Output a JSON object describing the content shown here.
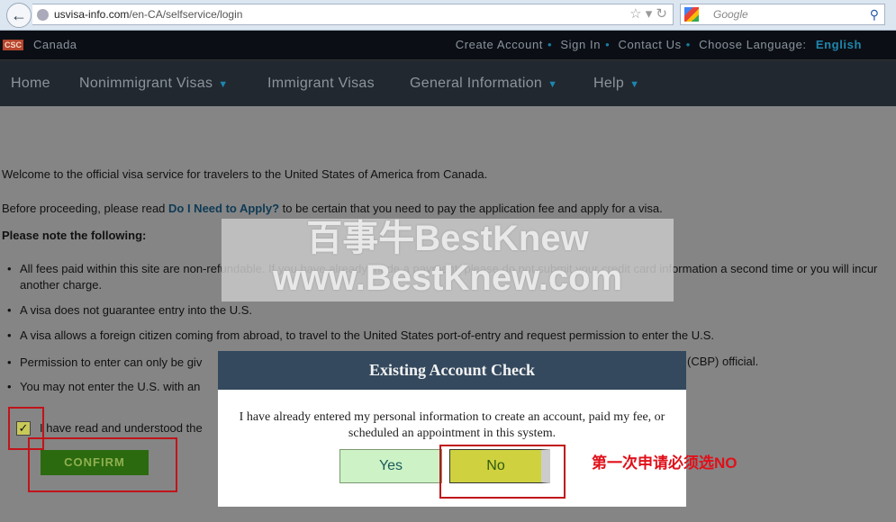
{
  "browser": {
    "url_host": "usvisa-info.com",
    "url_path": "/en-CA/selfservice/login",
    "search_placeholder": "Google"
  },
  "top": {
    "logo": "CSC",
    "country": "Canada",
    "links": [
      "Create Account",
      "Sign In",
      "Contact Us"
    ],
    "choose_language": "Choose Language:",
    "language": "English"
  },
  "nav": {
    "items": [
      "Home",
      "Nonimmigrant Visas",
      "Immigrant Visas",
      "General Information",
      "Help"
    ]
  },
  "content": {
    "welcome": "Welcome to the official visa service for travelers to the United States of America from Canada.",
    "before": "Before proceeding, please read ",
    "link": "Do I Need to Apply?",
    "after": " to be certain that you need to pay the application fee and apply for a visa.",
    "note_heading": "Please note the following:",
    "bullets": [
      "All fees paid within this site are non-refundable. If you have already made a payment, please do not submit your credit card information a second time or you will incur another charge.",
      "A visa does not guarantee entry into the U.S.",
      "A visa allows a foreign citizen coming from abroad, to travel to the United States port-of-entry and request permission to enter the U.S.",
      "Permission to enter can only be giv",
      "(CBP) official.",
      "You may not enter the U.S. with an"
    ],
    "checkbox_label": "I have read and understood the",
    "confirm": "CONFIRM"
  },
  "watermark": {
    "line1": "百事牛BestKnew",
    "line2": "www.BestKnew.com"
  },
  "modal": {
    "title": "Existing Account Check",
    "text": "I have already entered my personal information to create an account, paid my fee, or scheduled an appointment in this system.",
    "yes": "Yes",
    "no": "No"
  },
  "annotation": "第一次申请必须选NO"
}
